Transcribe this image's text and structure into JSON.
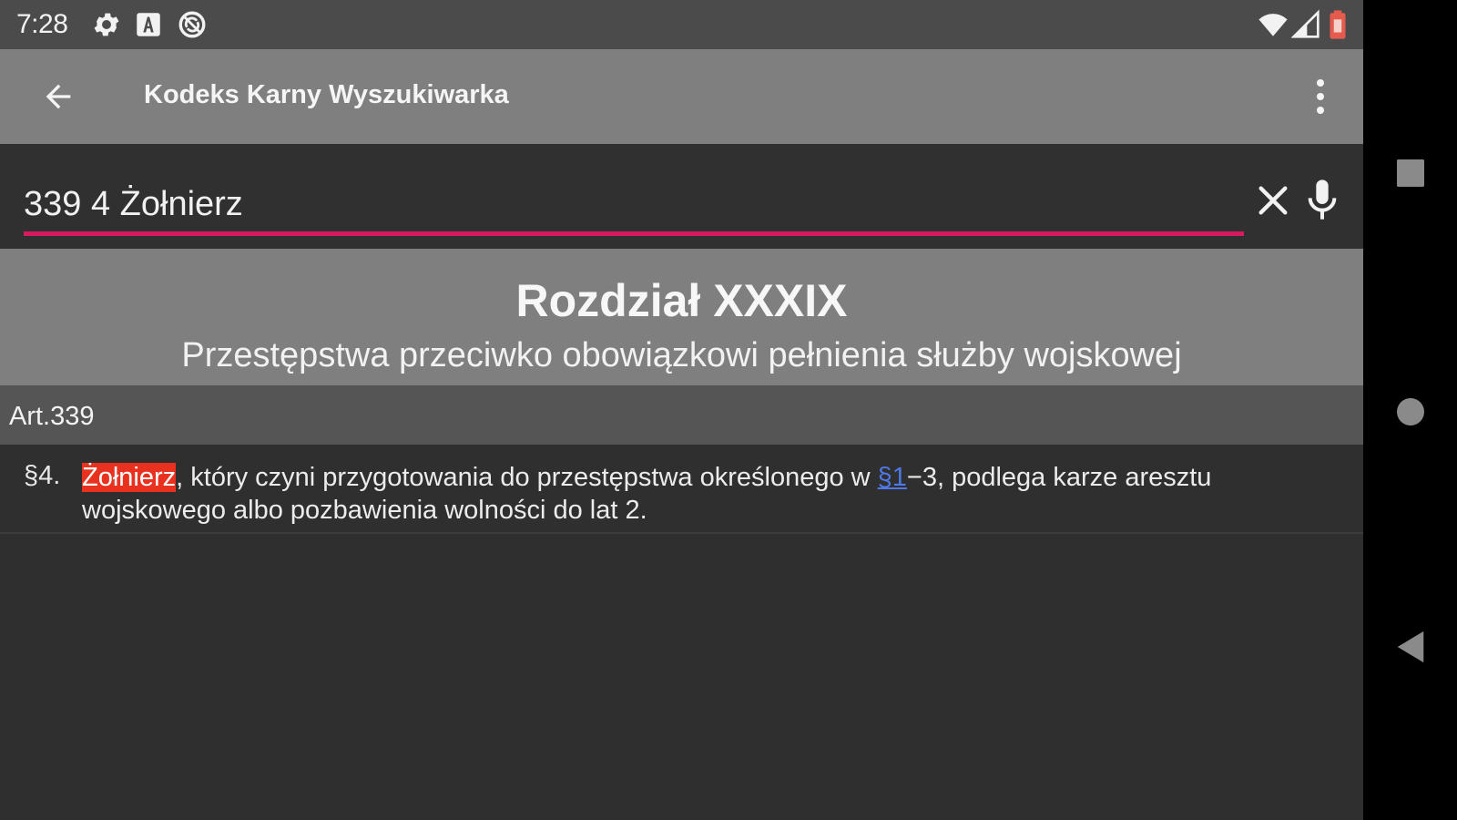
{
  "status_bar": {
    "time": "7:28",
    "icons_left": [
      "gear-icon",
      "a-box-icon",
      "sync-icon"
    ],
    "icons_right": [
      "wifi-icon",
      "signal-icon",
      "battery-icon"
    ]
  },
  "toolbar": {
    "title": "Kodeks Karny Wyszukiwarka",
    "back_icon": "arrow-left-icon",
    "menu_icon": "more-vert-icon"
  },
  "search": {
    "value": "339 4 Żołnierz",
    "accent_color": "#d7195d"
  },
  "chapter": {
    "title": "Rozdział XXXIX",
    "subtitle": "Przestępstwa przeciwko obowiązkowi pełnienia służby wojskowej"
  },
  "article": {
    "label": "Art.339",
    "paragraph": {
      "number": "§4.",
      "highlight": "Żołnierz",
      "text_before_link": ", który czyni przygotowania do przestępstwa określonego w ",
      "link": "§1",
      "text_after_link": "−3, podlega karze aresztu wojskowego albo pozbawienia wolności do lat 2."
    }
  },
  "colors": {
    "highlight": "#e8321f",
    "link": "#4f78e6",
    "header_gray": "#7f7f7f",
    "background": "#2f2f2f"
  },
  "navigation": {
    "buttons": [
      "recents-icon",
      "home-icon",
      "back-icon"
    ]
  }
}
